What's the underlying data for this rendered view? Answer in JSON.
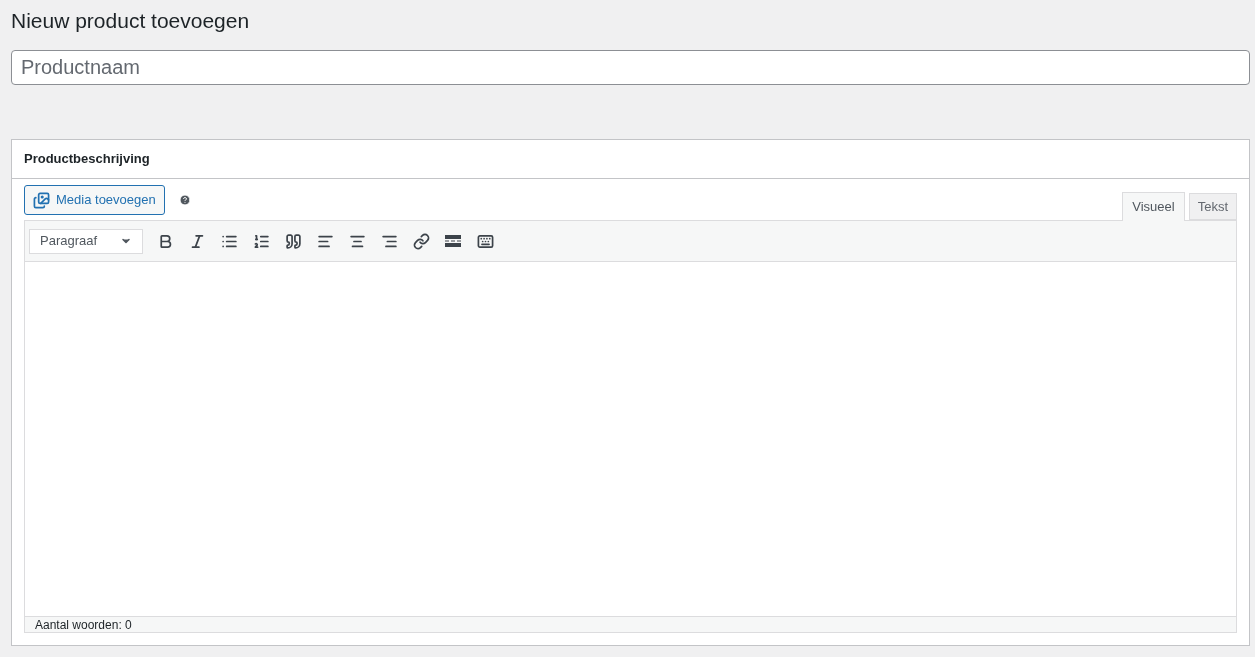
{
  "page_title": "Nieuw product toevoegen",
  "product_name": {
    "placeholder": "Productnaam"
  },
  "description_box": {
    "title": "Productbeschrijving",
    "media_button": "Media toevoegen",
    "tabs": [
      {
        "label": "Visueel",
        "selected": true
      },
      {
        "label": "Tekst",
        "selected": false
      }
    ],
    "format_select": {
      "value": "Paragraaf"
    },
    "status_bar": "Aantal woorden: 0"
  }
}
